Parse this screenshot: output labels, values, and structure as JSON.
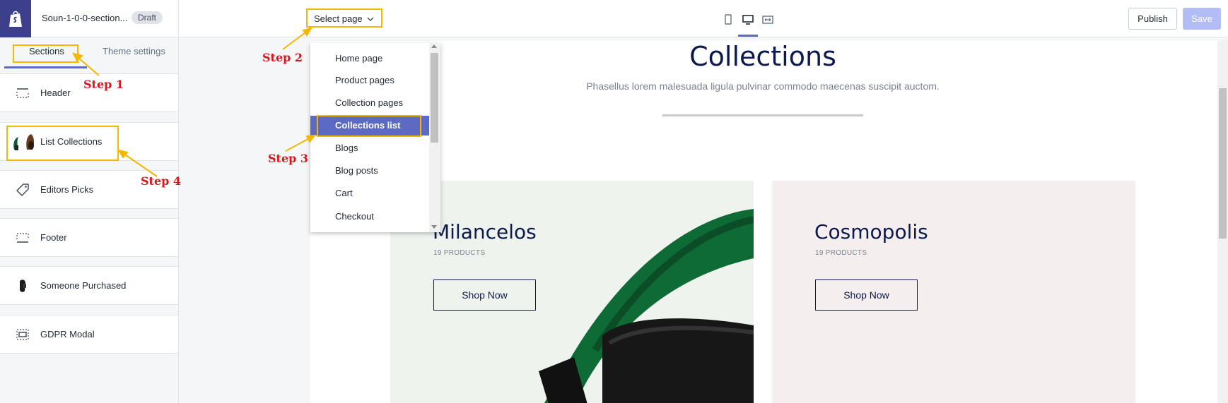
{
  "topbar": {
    "theme_title": "Soun-1-0-0-section...",
    "draft_badge": "Draft",
    "select_page": "Select page",
    "publish": "Publish",
    "save": "Save",
    "device_icons": [
      "mobile-icon",
      "desktop-icon",
      "fullwidth-icon"
    ],
    "active_device": "desktop"
  },
  "sidebar": {
    "tabs": [
      {
        "label": "Sections",
        "active": true
      },
      {
        "label": "Theme settings",
        "active": false
      }
    ],
    "items": [
      {
        "label": "Header",
        "icon": "header-layout-icon"
      },
      {
        "label": "List Collections",
        "icon": "collection-thumbnail-icon"
      },
      {
        "label": "Editors Picks",
        "icon": "tag-icon"
      },
      {
        "label": "Footer",
        "icon": "footer-layout-icon"
      },
      {
        "label": "Someone Purchased",
        "icon": "product-thumbnail-icon"
      },
      {
        "label": "GDPR Modal",
        "icon": "modal-layout-icon"
      }
    ]
  },
  "dropdown": {
    "items": [
      {
        "label": "Home page",
        "selected": false
      },
      {
        "label": "Product pages",
        "selected": false
      },
      {
        "label": "Collection pages",
        "selected": false
      },
      {
        "label": "Collections list",
        "selected": true
      },
      {
        "label": "Blogs",
        "selected": false
      },
      {
        "label": "Blog posts",
        "selected": false
      },
      {
        "label": "Cart",
        "selected": false
      },
      {
        "label": "Checkout",
        "selected": false
      }
    ]
  },
  "preview": {
    "title": "Collections",
    "subtitle": "Phasellus lorem malesuada ligula pulvinar commodo maecenas suscipit auctom.",
    "cards": [
      {
        "name": "Milancelos",
        "count": "19 PRODUCTS",
        "button": "Shop Now"
      },
      {
        "name": "Cosmopolis",
        "count": "19 PRODUCTS",
        "button": "Shop Now"
      }
    ]
  },
  "annotations": {
    "steps": [
      "Step 1",
      "Step 2",
      "Step 3",
      "Step 4"
    ],
    "highlight_color": "#f5b800",
    "label_color": "#d8161d"
  },
  "colors": {
    "accent": "#5c6ac4",
    "logo_bg": "#3b3f8c",
    "heading": "#0d1a4b",
    "save_disabled": "#b3bcf5"
  }
}
